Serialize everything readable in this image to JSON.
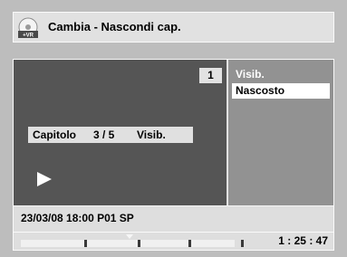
{
  "header": {
    "title": "Cambia - Nascondi cap.",
    "disc_badge": "+VR"
  },
  "preview": {
    "chapter_number": "1",
    "chapter_label": "Capitolo",
    "chapter_position": "3 / 5",
    "chapter_status": "Visib.",
    "play_state_icon": "play-icon"
  },
  "menu": {
    "options": [
      "Visib.",
      "Nascosto"
    ],
    "selected_index": 1
  },
  "info": {
    "date": "23/03/08",
    "time": "18:00",
    "channel": "P01",
    "mode": "SP",
    "line": "23/03/08  18:00  P01  SP"
  },
  "status": {
    "elapsed": "1 : 25 : 47",
    "chapter_count": 5,
    "playback_position_fraction": 0.51
  },
  "colors": {
    "background": "#bdbdbd",
    "panel": "#dedede",
    "preview": "#555555",
    "side_panel": "#929292",
    "highlight": "#ffffff"
  }
}
